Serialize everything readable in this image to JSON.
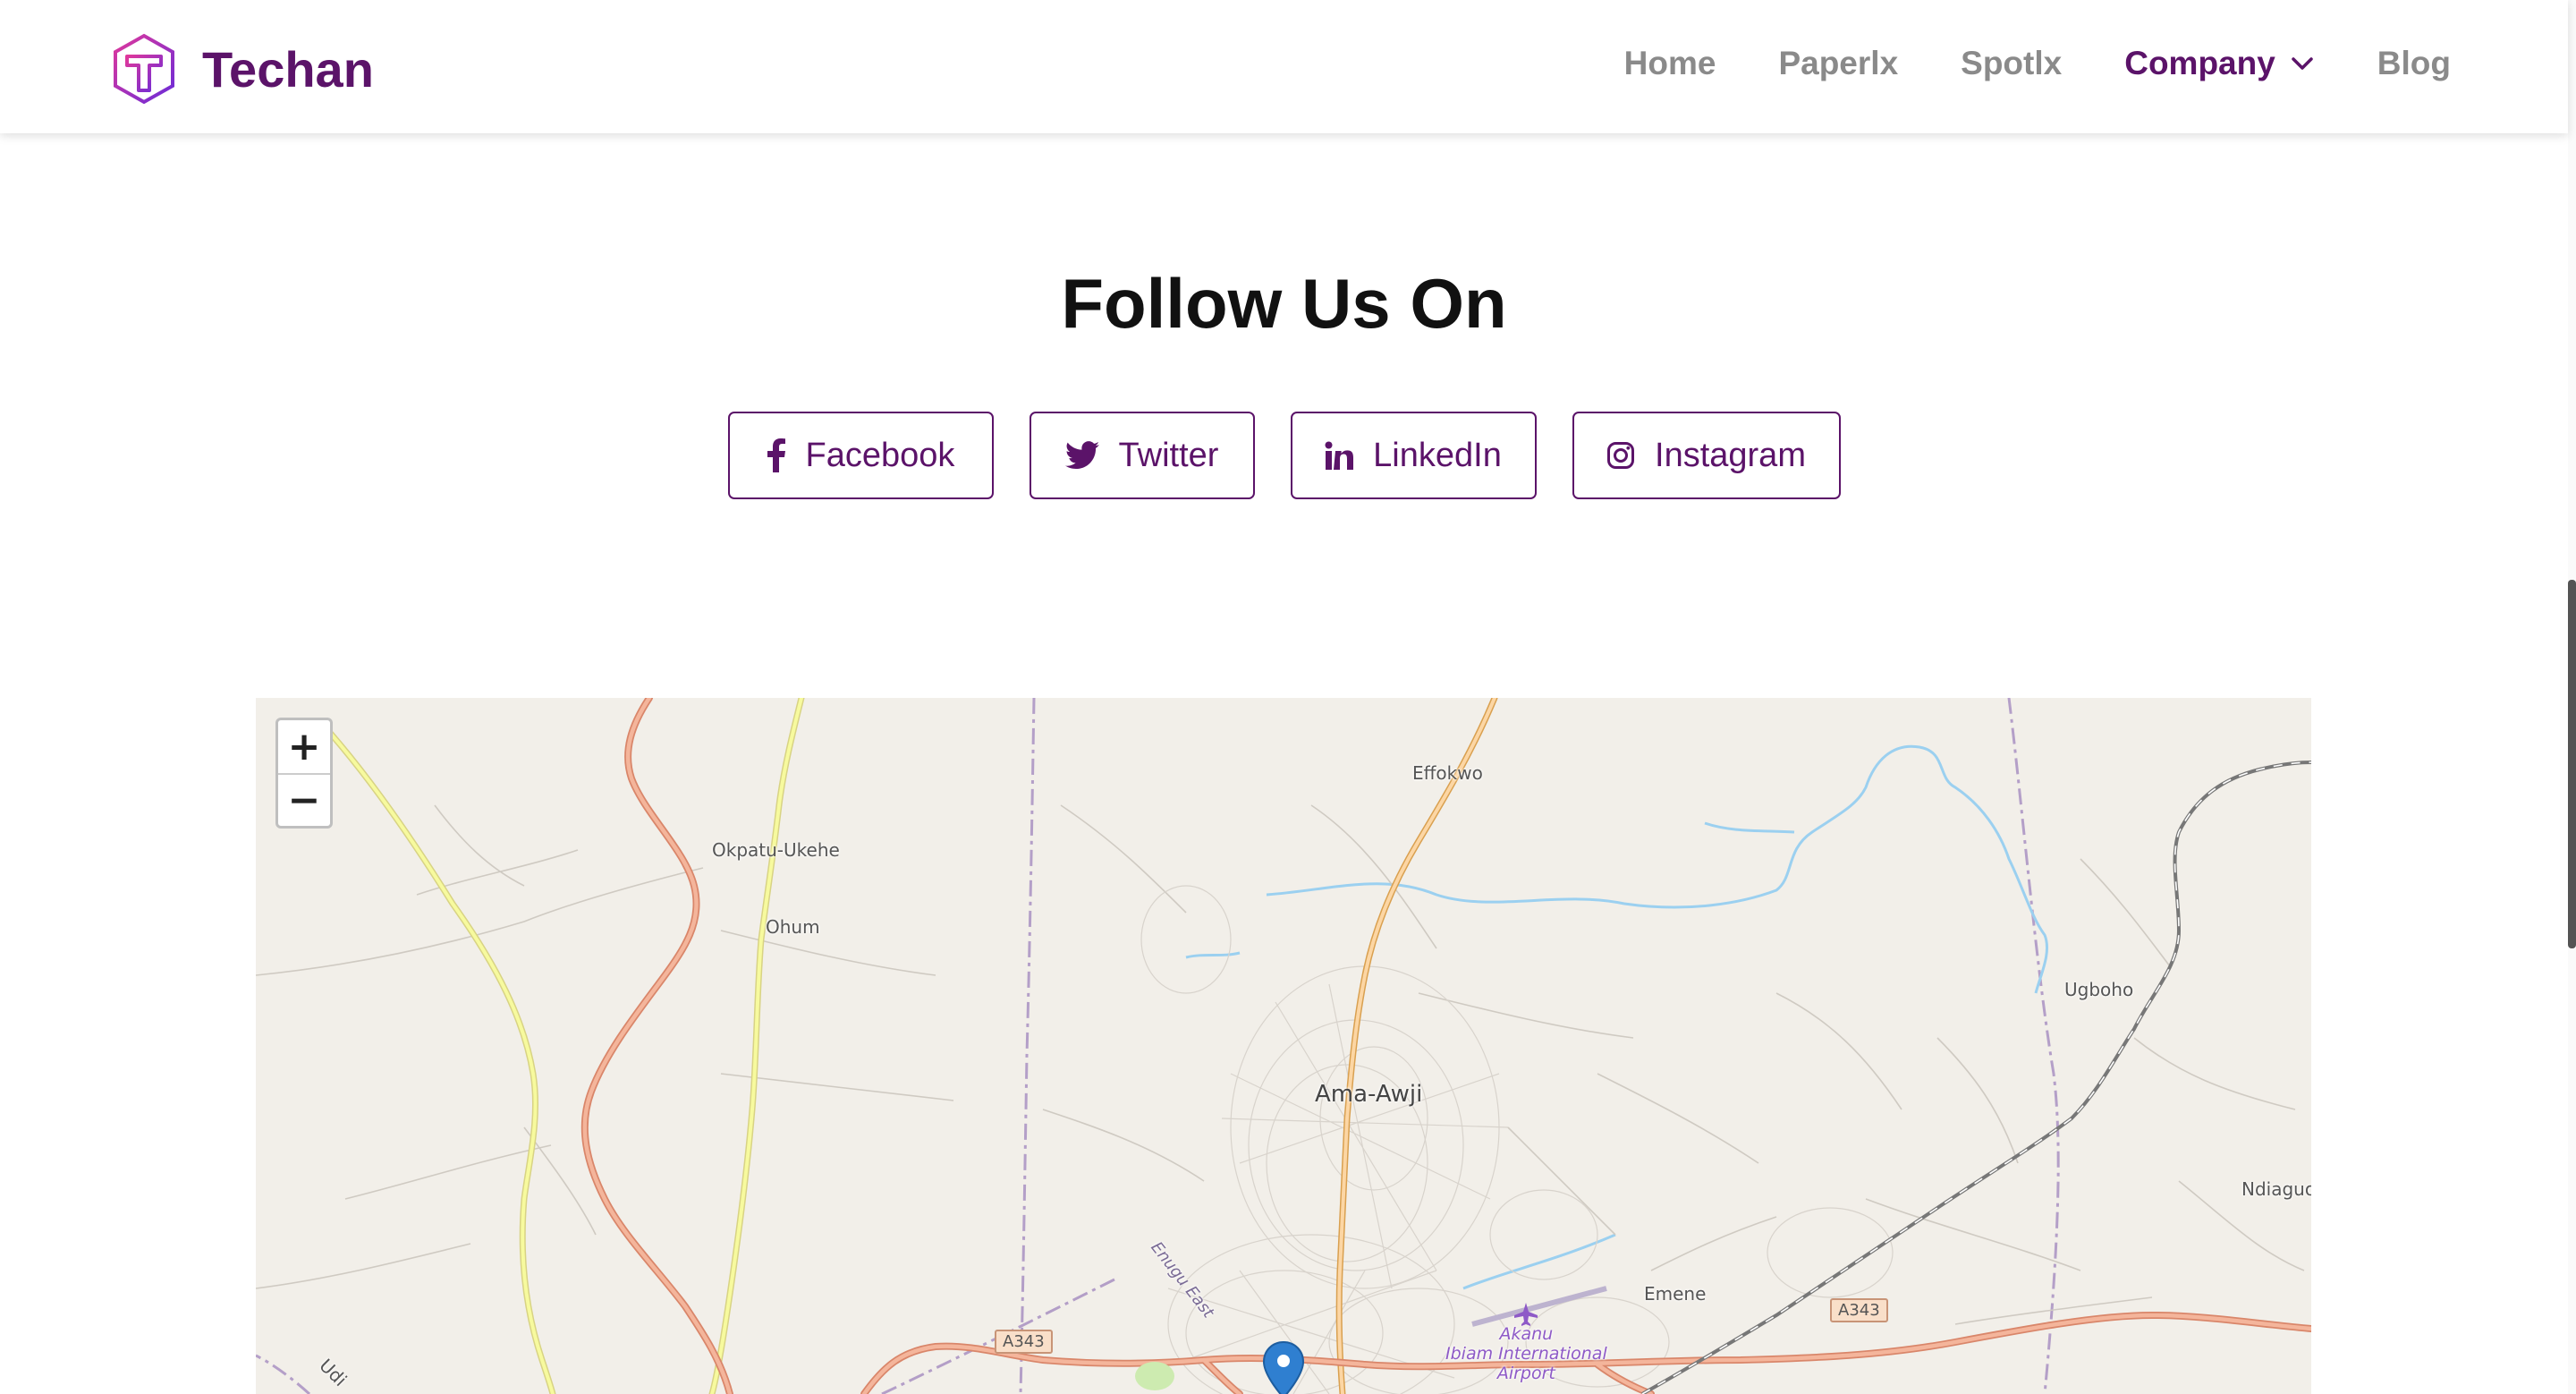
{
  "brand": {
    "name": "Techan",
    "color": "#5b1369"
  },
  "nav": {
    "items": [
      {
        "label": "Home",
        "active": false
      },
      {
        "label": "Paperlx",
        "active": false
      },
      {
        "label": "Spotlx",
        "active": false
      },
      {
        "label": "Company",
        "active": true,
        "has_dropdown": true,
        "icon": "chevron-down-icon"
      },
      {
        "label": "Blog",
        "active": false
      }
    ]
  },
  "follow": {
    "title": "Follow Us On",
    "buttons": [
      {
        "label": "Facebook",
        "icon": "facebook-icon"
      },
      {
        "label": "Twitter",
        "icon": "twitter-icon"
      },
      {
        "label": "LinkedIn",
        "icon": "linkedin-icon"
      },
      {
        "label": "Instagram",
        "icon": "instagram-icon"
      }
    ]
  },
  "map": {
    "zoom_in": "+",
    "zoom_out": "−",
    "places": {
      "effokwo": "Effokwo",
      "okpatu_ukehe": "Okpatu-Ukehe",
      "ohum": "Ohum",
      "ama_awji": "Ama-Awji",
      "ugboho": "Ugboho",
      "ndiaguo": "Ndiaguo",
      "emene": "Emene",
      "udi": "Udi",
      "enugu_east": "Enugu East",
      "airport_line1": "Akanu",
      "airport_line2": "Ibiam International",
      "airport_line3": "Airport"
    },
    "road_shields": {
      "a343_left": "A343",
      "a343_right": "A343"
    },
    "colors": {
      "land": "#f2efe9",
      "trunk_road": "#e59c7f",
      "secondary_road": "#efe87a",
      "primary_road": "#f0b35a",
      "river": "#9bd0f0",
      "railway": "#707070",
      "boundary": "#a48bbf",
      "marker": "#2f7fd0"
    }
  }
}
